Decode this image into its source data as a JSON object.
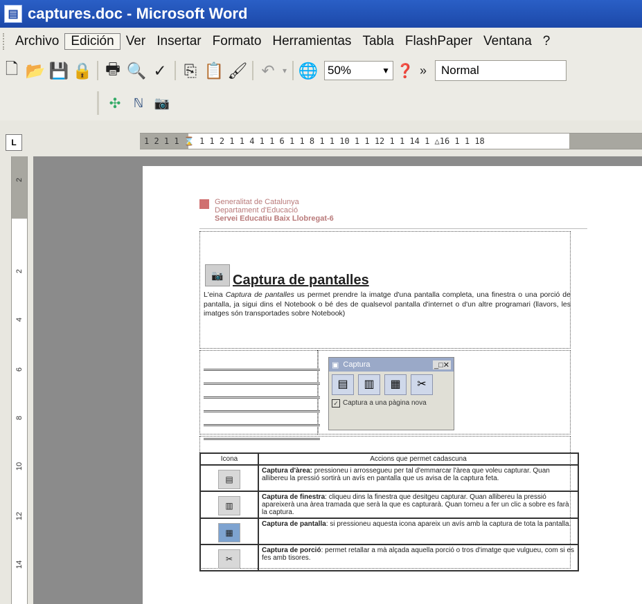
{
  "window": {
    "title": "captures.doc - Microsoft Word"
  },
  "menu": [
    "Archivo",
    "Edición",
    "Ver",
    "Insertar",
    "Formato",
    "Herramientas",
    "Tabla",
    "FlashPaper",
    "Ventana",
    "?"
  ],
  "toolbar": {
    "zoom": "50%",
    "style": "Normal"
  },
  "ruler": {
    "ticks": "1 2 1   1 ⌛ 1   1 2 1   1 4 1   1 6 1   1 8 1   1 10 1   1 12 1   1 14 1   △16 1   1 18"
  },
  "vruler": {
    "ticks": [
      "2",
      "2",
      "4",
      "6",
      "8",
      "10",
      "12",
      "14"
    ]
  },
  "doc": {
    "header_l1": "Generalitat de Catalunya",
    "header_l2": "Departament d'Educació",
    "header_l3": "Servei Educatiu Baix Llobregat-6",
    "title": "Captura de pantalles",
    "intro_pre": "L'eina ",
    "intro_em": "Captura de pantalles",
    "intro_post": " us permet prendre la imatge d'una pantalla completa, una finestra o una porció de pantalla, ja sigui dins el Notebook o bé des de qualsevol pantalla d'internet o d'un altre programari (llavors, les imatges són transportades sobre Notebook)",
    "panel_title": "Captura",
    "panel_check": "Captura a una pàgina nova",
    "table": {
      "col1": "Icona",
      "col2": "Accions que permet cadascuna",
      "rows": [
        {
          "bold": "Captura d'àrea:",
          "text": " pressioneu i arrossegueu per tal d'emmarcar l'àrea que voleu capturar. Quan allibereu la pressió sortirà un avís en pantalla que us avisa de la captura feta."
        },
        {
          "bold": "Captura de finestra",
          "text": ": cliqueu dins la finestra que desitgeu capturar. Quan allibereu la pressió apareixerà una àrea tramada que serà la que es capturarà. Quan torneu a fer un clic a sobre es farà la captura."
        },
        {
          "bold": "Captura de pantalla",
          "text": ": si pressioneu aquesta icona apareix un avís amb la captura de tota la pantalla."
        },
        {
          "bold": "Captura de porció",
          "text": ": permet retallar a mà alçada aquella porció o tros d'imatge que vulgueu, com si es fes amb tisores."
        }
      ]
    }
  }
}
